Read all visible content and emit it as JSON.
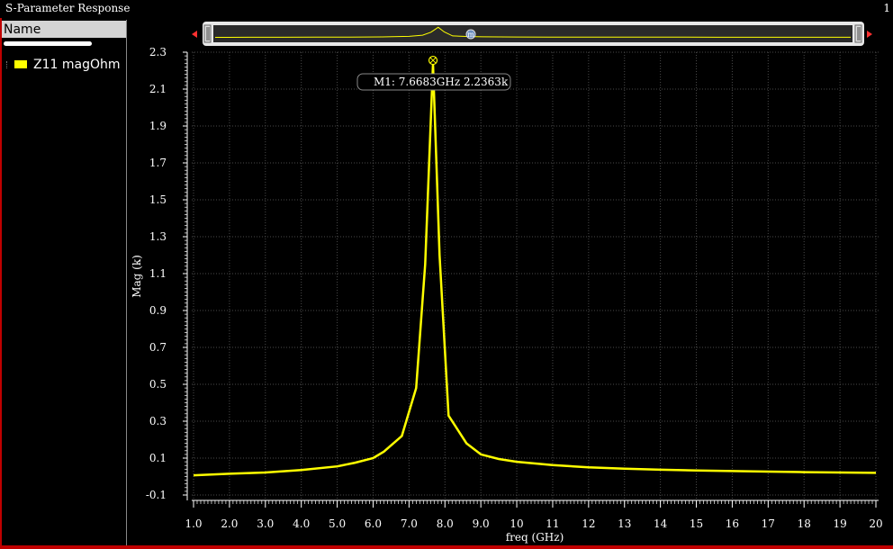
{
  "window": {
    "title": "S-Parameter Response",
    "index": "1"
  },
  "legend": {
    "header": "Name",
    "items": [
      {
        "label": "Z11 magOhm",
        "color": "#ffff00"
      }
    ]
  },
  "marker": {
    "symbol": "m",
    "label": "M1: 7.6683GHz 2.2363k"
  },
  "colors": {
    "background": "#000000",
    "trace": "#ffff00",
    "grid": "#555555",
    "axis": "#ffffff"
  },
  "chart_data": {
    "type": "line",
    "title": "",
    "xlabel": "freq (GHz)",
    "ylabel": "Mag (k)",
    "xlim": [
      1.0,
      20
    ],
    "ylim": [
      -0.1,
      2.3
    ],
    "xticks": [
      "1.0",
      "2.0",
      "3.0",
      "4.0",
      "5.0",
      "6.0",
      "7.0",
      "8.0",
      "9.0",
      "10",
      "11",
      "12",
      "13",
      "14",
      "15",
      "16",
      "17",
      "18",
      "19",
      "20"
    ],
    "yticks": [
      "2.3",
      "2.1",
      "1.9",
      "1.7",
      "1.5",
      "1.3",
      "1.1",
      "0.9",
      "0.7",
      "0.5",
      "0.3",
      "0.1",
      "-0.1"
    ],
    "grid": true,
    "series": [
      {
        "name": "Z11 magOhm",
        "x": [
          1.0,
          2.0,
          3.0,
          4.0,
          5.0,
          5.5,
          6.0,
          6.3,
          6.8,
          7.2,
          7.45,
          7.6683,
          7.85,
          8.1,
          8.6,
          9.0,
          9.5,
          10,
          11,
          12,
          13,
          14,
          15,
          16,
          17,
          18,
          19,
          20
        ],
        "y": [
          0.007,
          0.015,
          0.022,
          0.035,
          0.055,
          0.075,
          0.1,
          0.135,
          0.22,
          0.48,
          1.15,
          2.2363,
          1.2,
          0.33,
          0.18,
          0.12,
          0.095,
          0.08,
          0.062,
          0.05,
          0.043,
          0.037,
          0.033,
          0.03,
          0.027,
          0.024,
          0.022,
          0.02
        ]
      }
    ],
    "markers": [
      {
        "name": "M1",
        "x": 7.6683,
        "y": 2.2363
      }
    ]
  }
}
